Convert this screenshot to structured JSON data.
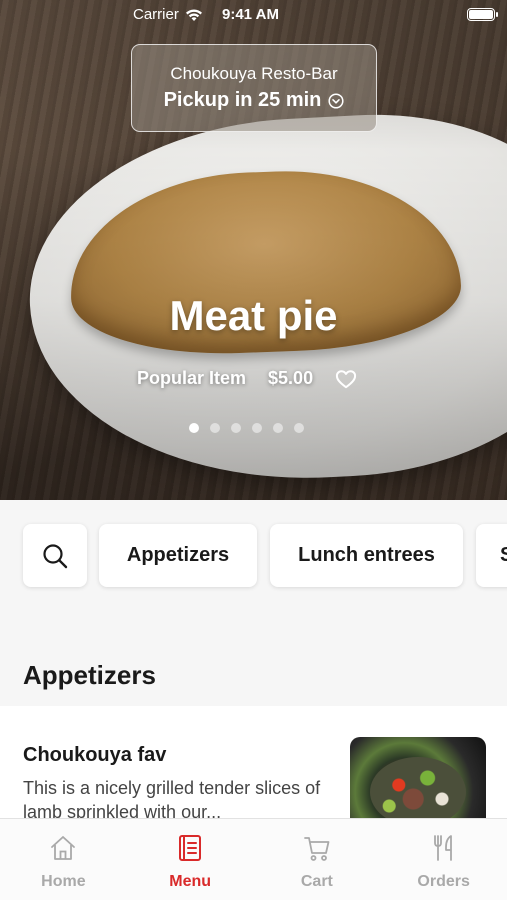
{
  "status_bar": {
    "carrier": "Carrier",
    "time": "9:41 AM"
  },
  "pickup": {
    "restaurant": "Choukouya Resto-Bar",
    "eta": "Pickup in 25 min"
  },
  "featured": {
    "title": "Meat pie",
    "tag": "Popular Item",
    "price": "$5.00",
    "favorite_icon": "heart-outline-icon"
  },
  "carousel": {
    "page_count": 6,
    "active_index": 0
  },
  "categories": {
    "search_icon": "search-icon",
    "items": [
      "Appetizers",
      "Lunch entrees",
      "S"
    ]
  },
  "section": {
    "title": "Appetizers"
  },
  "menu_items": [
    {
      "name": "Choukouya fav",
      "description": "This is a nicely grilled tender slices of lamb sprinkled with our..."
    }
  ],
  "tabbar": {
    "items": [
      {
        "label": "Home",
        "icon": "home-icon",
        "active": false
      },
      {
        "label": "Menu",
        "icon": "menu-book-icon",
        "active": true
      },
      {
        "label": "Cart",
        "icon": "cart-icon",
        "active": false
      },
      {
        "label": "Orders",
        "icon": "fork-knife-icon",
        "active": false
      }
    ]
  },
  "colors": {
    "accent": "#d92a2a",
    "inactive_tab": "#a9a9a9"
  }
}
